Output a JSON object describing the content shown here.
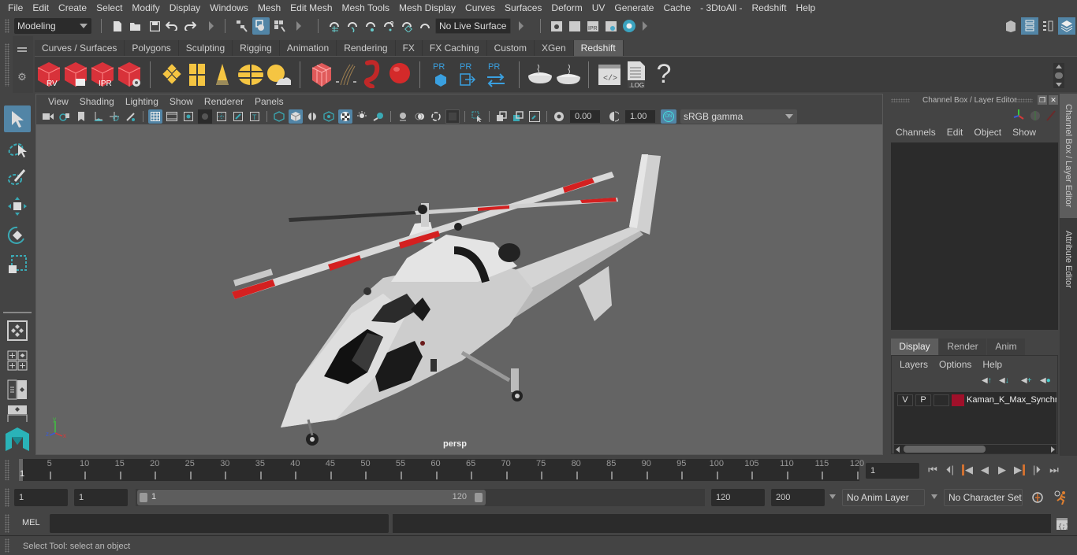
{
  "menubar": {
    "items": [
      "File",
      "Edit",
      "Create",
      "Select",
      "Modify",
      "Display",
      "Windows",
      "Mesh",
      "Edit Mesh",
      "Mesh Tools",
      "Mesh Display",
      "Curves",
      "Surfaces",
      "Deform",
      "UV",
      "Generate",
      "Cache",
      "- 3DtoAll -",
      "Redshift",
      "Help"
    ]
  },
  "statusline": {
    "workspace": "Modeling",
    "live_surface": "No Live Surface"
  },
  "shelf": {
    "tabs": [
      "Curves / Surfaces",
      "Polygons",
      "Sculpting",
      "Rigging",
      "Animation",
      "Rendering",
      "FX",
      "FX Caching",
      "Custom",
      "XGen",
      "Redshift"
    ],
    "active_tab": "Redshift",
    "icons": {
      "rv": "RV",
      "ipr": "IPR",
      "pr": "PR",
      "log": ".LOG",
      "help": "?"
    }
  },
  "viewport": {
    "menu": [
      "View",
      "Shading",
      "Lighting",
      "Show",
      "Renderer",
      "Panels"
    ],
    "exposure": "0.00",
    "gamma": "1.00",
    "color_toggle": "ON",
    "color_space": "sRGB gamma",
    "camera_label": "persp",
    "axis": {
      "x": "x",
      "y": "y",
      "z": "z"
    }
  },
  "channelbox": {
    "title": "Channel Box / Layer Editor",
    "menu": [
      "Channels",
      "Edit",
      "Object",
      "Show"
    ]
  },
  "layer_editor": {
    "tabs": [
      "Display",
      "Render",
      "Anim"
    ],
    "active_tab": "Display",
    "menu": [
      "Layers",
      "Options",
      "Help"
    ],
    "layers": [
      {
        "v": "V",
        "p": "P",
        "color": "#a0102a",
        "name": "Kaman_K_Max_Synchro"
      }
    ]
  },
  "side_tabs": [
    "Channel Box / Layer Editor",
    "Attribute Editor"
  ],
  "timeline": {
    "ticks": [
      5,
      10,
      15,
      20,
      25,
      30,
      35,
      40,
      45,
      50,
      55,
      60,
      65,
      70,
      75,
      80,
      85,
      90,
      95,
      100,
      105,
      110,
      115,
      120
    ],
    "current_frame_marker": "1",
    "current_frame": "1",
    "range_min": 1,
    "range_max": 120
  },
  "range": {
    "start": "1",
    "playback_start": "1",
    "slider_start": "1",
    "slider_end": "120",
    "playback_end": "120",
    "end": "200",
    "anim_layer": "No Anim Layer",
    "character_set": "No Character Set"
  },
  "command": {
    "lang": "MEL"
  },
  "help_line": "Select Tool: select an object"
}
